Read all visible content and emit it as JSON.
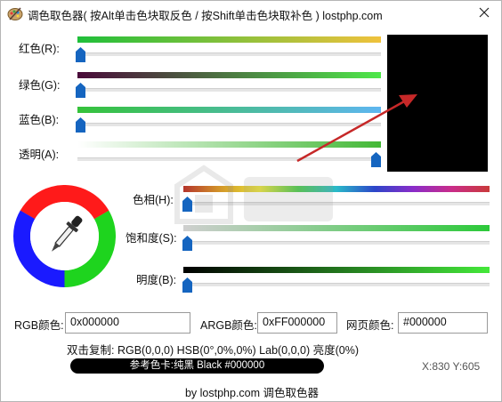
{
  "window": {
    "title": "调色取色器( 按Alt单击色块取反色 / 按Shift单击色块取补色 ) lostphp.com"
  },
  "sliders": {
    "red_label": "红色(R):",
    "green_label": "绿色(G):",
    "blue_label": "蓝色(B):",
    "alpha_label": "透明(A):",
    "hue_label": "色相(H):",
    "saturation_label": "饱和度(S):",
    "brightness_label": "明度(B):"
  },
  "slider_values": {
    "red": 0,
    "green": 0,
    "blue": 0,
    "alpha": 255,
    "hue": 0,
    "saturation": 0,
    "brightness": 0
  },
  "fields": {
    "rgb_label": "RGB颜色:",
    "rgb_value": "0x000000",
    "argb_label": "ARGB颜色:",
    "argb_value": "0xFF000000",
    "web_label": "网页颜色:",
    "web_value": "#000000"
  },
  "copy_line": "双击复制: RGB(0,0,0) HSB(0°,0%,0%) Lab(0,0,0) 亮度(0%)",
  "reference_card": "参考色卡:纯黑 Black #000000",
  "coords": "X:830 Y:605",
  "footer": "by lostphp.com 调色取色器",
  "preview_color": "#000000",
  "colors": {
    "thumb": "#1565c0",
    "arrow": "#c62828"
  },
  "icons": {
    "app": "palette-icon",
    "close": "close-icon",
    "eyedropper": "eyedropper-icon"
  }
}
